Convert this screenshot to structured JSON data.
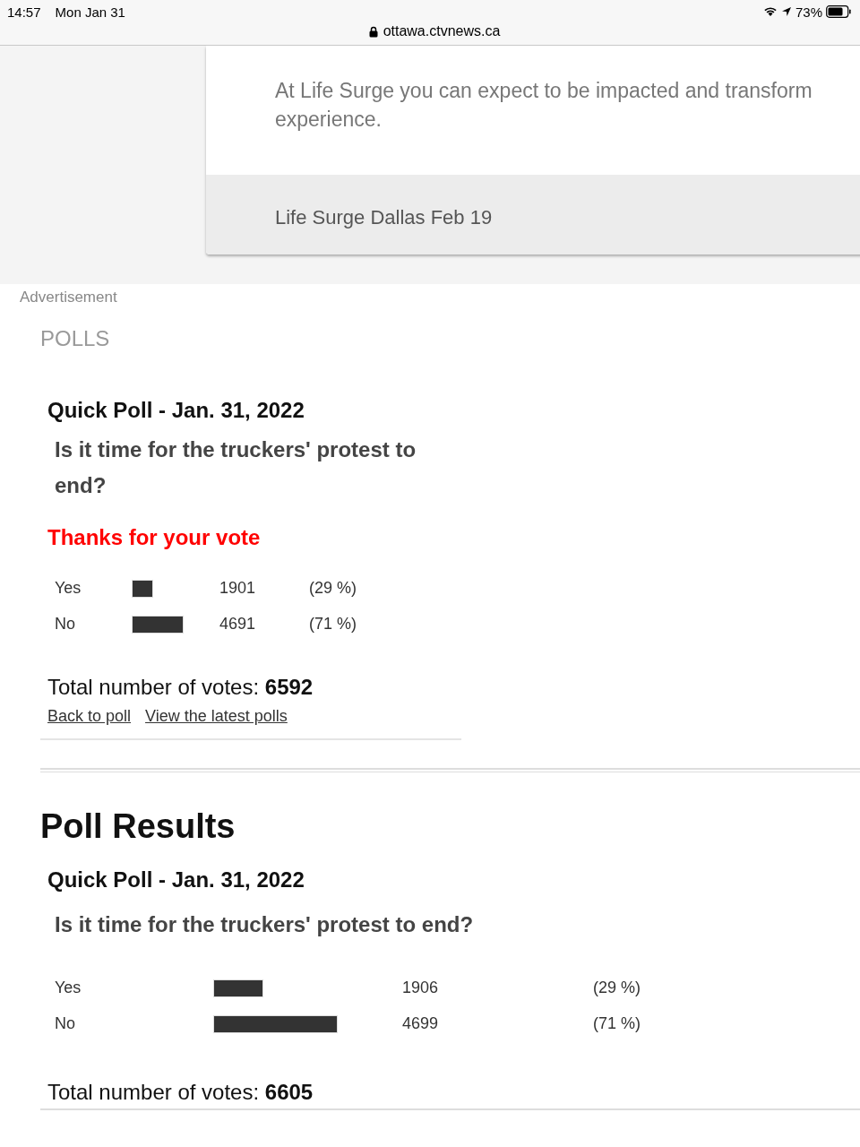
{
  "status_bar": {
    "time": "14:57",
    "date": "Mon Jan 31",
    "battery": "73%"
  },
  "address_bar": {
    "url": "ottawa.ctvnews.ca"
  },
  "promo_card": {
    "text": "At Life Surge you can expect to be impacted and transform",
    "text_line2": "experience.",
    "footer": "Life Surge Dallas Feb 19"
  },
  "ad_label": "Advertisement",
  "section_title": "POLLS",
  "poll": {
    "title": "Quick Poll - Jan. 31, 2022",
    "question": "Is it time for the truckers' protest to end?",
    "message": "Thanks for your vote",
    "results": [
      {
        "label": "Yes",
        "count": "1901",
        "percent": "(29 %)"
      },
      {
        "label": "No",
        "count": "4691",
        "percent": "(71 %)"
      }
    ],
    "total_label": "Total number of votes:",
    "total": "6592",
    "links": [
      "Back to poll",
      "View the latest polls"
    ]
  },
  "results_heading": "Poll Results",
  "results_poll": {
    "title": "Quick Poll - Jan. 31, 2022",
    "question": "Is it time for the truckers' protest to end?",
    "results": [
      {
        "label": "Yes",
        "count": "1906",
        "percent": "(29 %)"
      },
      {
        "label": "No",
        "count": "4699",
        "percent": "(71 %)"
      }
    ],
    "total_label": "Total number of votes:",
    "total": "6605"
  }
}
